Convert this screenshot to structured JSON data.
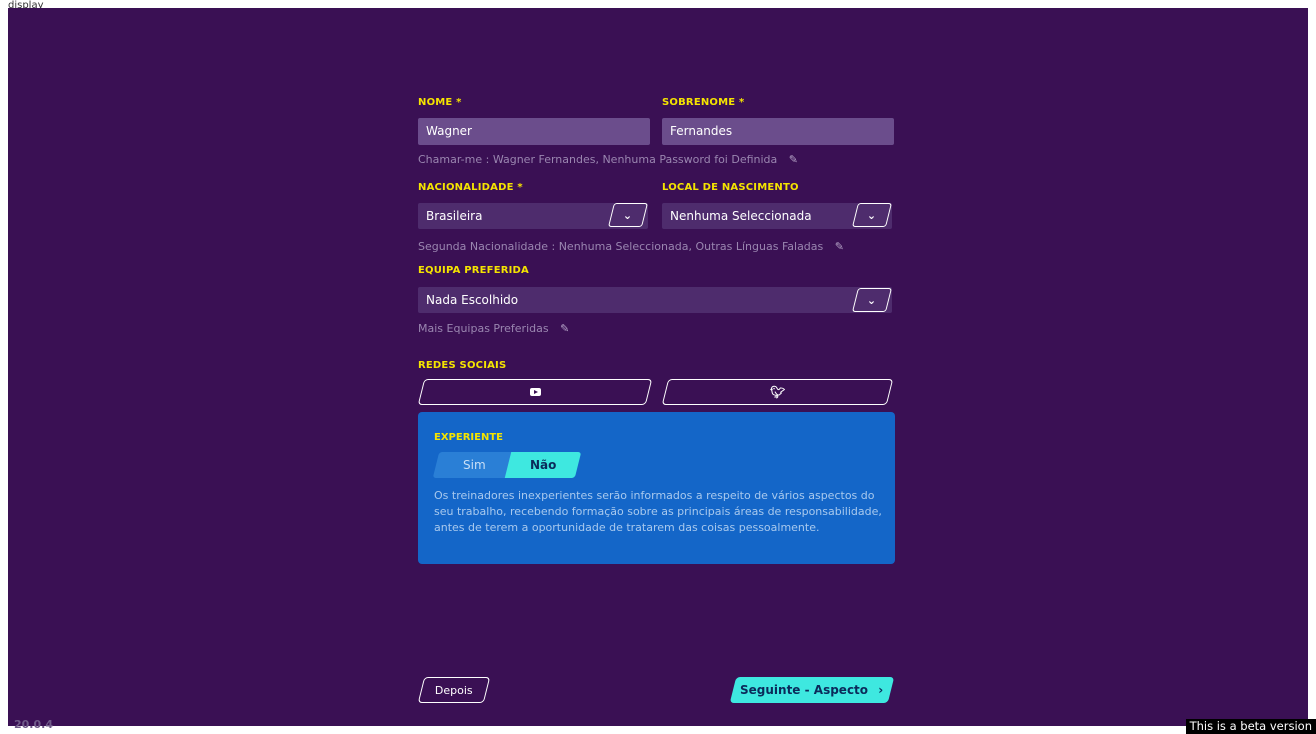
{
  "top_label": "display_",
  "form": {
    "nome_label": "NOME *",
    "nome_value": "Wagner",
    "sobrenome_label": "SOBRENOME *",
    "sobrenome_value": "Fernandes",
    "chamar_me_text": "Chamar-me : Wagner Fernandes, Nenhuma Password foi Definida",
    "nacionalidade_label": "NACIONALIDADE *",
    "nacionalidade_value": "Brasileira",
    "local_label": "LOCAL DE NASCIMENTO",
    "local_value": "Nenhuma Seleccionada",
    "segunda_text": "Segunda Nacionalidade : Nenhuma Seleccionada, Outras Línguas Faladas",
    "equipa_label": "EQUIPA PREFERIDA",
    "equipa_value": "Nada Escolhido",
    "mais_equipas_text": "Mais Equipas Preferidas",
    "redes_label": "REDES SOCIAIS"
  },
  "experiente": {
    "title": "EXPERIENTE",
    "option_sim": "Sim",
    "option_nao": "Não",
    "selected": "Não",
    "description": "Os treinadores inexperientes serão informados a respeito de vários aspectos do seu trabalho, recebendo formação sobre as principais áreas de responsabilidade, antes de terem a oportunidade de tratarem das coisas pessoalmente."
  },
  "footer": {
    "depois_label": "Depois",
    "next_label": "Seguinte - Aspecto",
    "next_icon": "›",
    "version": "20.0.4",
    "beta_notice": "This is a beta version"
  },
  "icons": {
    "pencil": "✎",
    "chevron": "⌄",
    "youtube": "youtube-icon",
    "twitter": "twitter-icon"
  },
  "colors": {
    "background": "#3a1054",
    "accent_yellow": "#f5e400",
    "accent_cyan": "#3ee8e0",
    "panel_blue": "#1466c8"
  }
}
